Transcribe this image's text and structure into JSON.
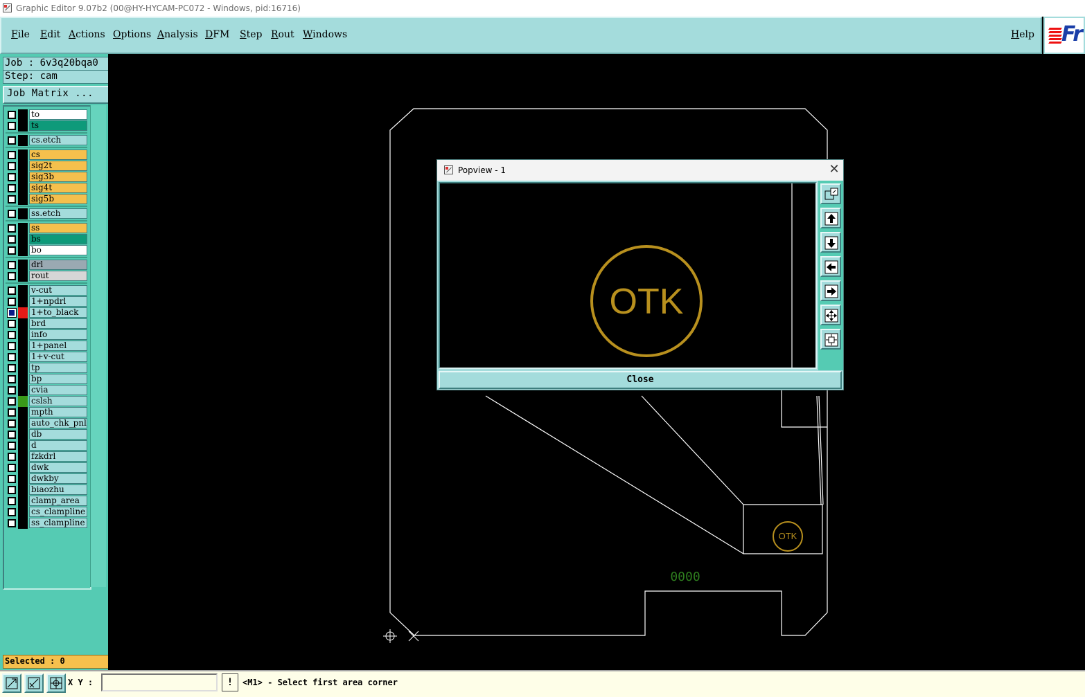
{
  "window": {
    "title": "Graphic Editor 9.07b2 (00@HY-HYCAM-PC072 - Windows, pid:16716)"
  },
  "menu": {
    "items": [
      "File",
      "Edit",
      "Actions",
      "Options",
      "Analysis",
      "DFM",
      "Step",
      "Rout",
      "Windows"
    ],
    "help": "Help"
  },
  "logo": {
    "text": "Fr"
  },
  "left_panel": {
    "job": "Job : 6v3q20bqa0",
    "step": "Step: cam",
    "job_matrix_label": "Job Matrix ...",
    "selected": "Selected : 0"
  },
  "layers": [
    {
      "name": "to",
      "color": "#ffffff",
      "swatch": "#000000"
    },
    {
      "name": "ts",
      "color": "#0e9a7a",
      "swatch": "#000000"
    },
    {
      "name": "cs.etch",
      "color": "#a4dcdc",
      "swatch": "#000000"
    },
    {
      "name": "cs",
      "color": "#f5c04d",
      "swatch": "#000000"
    },
    {
      "name": "sig2t",
      "color": "#f5c04d",
      "swatch": "#000000"
    },
    {
      "name": "sig3b",
      "color": "#f5c04d",
      "swatch": "#000000"
    },
    {
      "name": "sig4t",
      "color": "#f5c04d",
      "swatch": "#000000"
    },
    {
      "name": "sig5b",
      "color": "#f5c04d",
      "swatch": "#000000"
    },
    {
      "name": "ss.etch",
      "color": "#a4dcdc",
      "swatch": "#000000"
    },
    {
      "name": "ss",
      "color": "#f5c04d",
      "swatch": "#000000"
    },
    {
      "name": "bs",
      "color": "#0e9a7a",
      "swatch": "#000000"
    },
    {
      "name": "bo",
      "color": "#ffffff",
      "swatch": "#000000"
    },
    {
      "name": "drl",
      "color": "#9aa9b2",
      "swatch": "#000000"
    },
    {
      "name": "rout",
      "color": "#d6d6d6",
      "swatch": "#000000"
    },
    {
      "name": "v-cut",
      "color": "#a4dcdc",
      "swatch": "#000000"
    },
    {
      "name": "1+npdrl",
      "color": "#a4dcdc",
      "swatch": "#000000"
    },
    {
      "name": "1+to_black",
      "color": "#a4dcdc",
      "swatch": "#e41b17",
      "active": true
    },
    {
      "name": "brd",
      "color": "#a4dcdc",
      "swatch": "#000000"
    },
    {
      "name": "info",
      "color": "#a4dcdc",
      "swatch": "#000000"
    },
    {
      "name": "1+panel",
      "color": "#a4dcdc",
      "swatch": "#000000"
    },
    {
      "name": "1+v-cut",
      "color": "#a4dcdc",
      "swatch": "#000000"
    },
    {
      "name": "tp",
      "color": "#a4dcdc",
      "swatch": "#000000"
    },
    {
      "name": "bp",
      "color": "#a4dcdc",
      "swatch": "#000000"
    },
    {
      "name": "cvia",
      "color": "#a4dcdc",
      "swatch": "#000000"
    },
    {
      "name": "cslsh",
      "color": "#a4dcdc",
      "swatch": "#3a9a1a"
    },
    {
      "name": "mpth",
      "color": "#a4dcdc",
      "swatch": "#000000"
    },
    {
      "name": "auto_chk_pnl",
      "color": "#a4dcdc",
      "swatch": "#000000"
    },
    {
      "name": "db",
      "color": "#a4dcdc",
      "swatch": "#000000"
    },
    {
      "name": "d",
      "color": "#a4dcdc",
      "swatch": "#000000"
    },
    {
      "name": "fzkdrl",
      "color": "#a4dcdc",
      "swatch": "#000000"
    },
    {
      "name": "dwk",
      "color": "#a4dcdc",
      "swatch": "#000000"
    },
    {
      "name": "dwkby",
      "color": "#a4dcdc",
      "swatch": "#000000"
    },
    {
      "name": "biaozhu",
      "color": "#a4dcdc",
      "swatch": "#000000"
    },
    {
      "name": "clamp_area",
      "color": "#a4dcdc",
      "swatch": "#000000"
    },
    {
      "name": "cs_clampline",
      "color": "#a4dcdc",
      "swatch": "#000000"
    },
    {
      "name": "ss_clampline",
      "color": "#a4dcdc",
      "swatch": "#000000"
    }
  ],
  "popview": {
    "title": "Popview - 1",
    "label": "OTK",
    "close_label": "Close",
    "close_x": "✕",
    "tools": [
      "zoom-window-icon",
      "pan-up-icon",
      "pan-down-icon",
      "pan-left-icon",
      "pan-right-icon",
      "zoom-in-icon",
      "zoom-out-icon"
    ]
  },
  "canvas": {
    "otk_label": "OTK",
    "small_text": "0000",
    "outline_color": "#ffffff",
    "feature_color": "#b8901e",
    "small_text_color": "#2e7d1e"
  },
  "status_bar": {
    "xy_label": "X Y :",
    "xy_value": "",
    "warn_label": "!",
    "message": "<M1> - Select first area corner"
  }
}
